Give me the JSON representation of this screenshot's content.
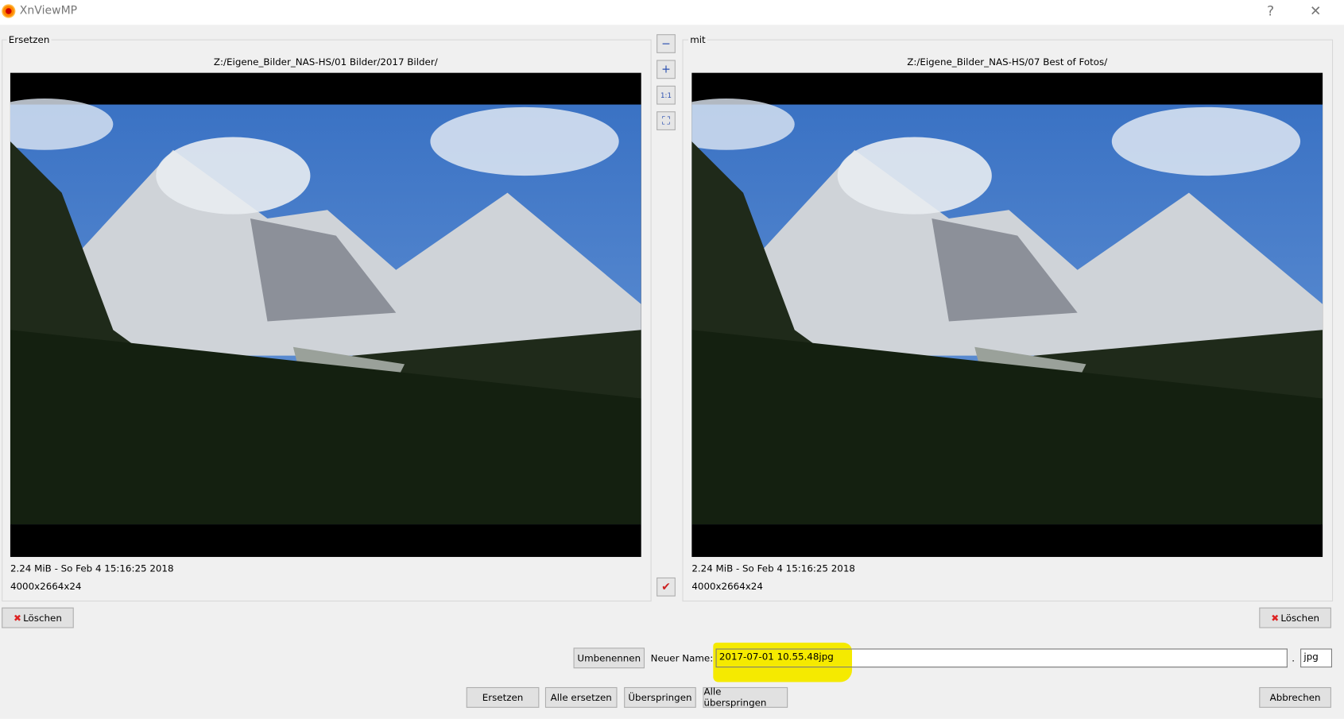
{
  "window": {
    "title": "XnViewMP",
    "help": "?",
    "close": "✕"
  },
  "left": {
    "group_label": "Ersetzen",
    "path": "Z:/Eigene_Bilder_NAS-HS/01 Bilder/2017 Bilder/",
    "info": "2.24 MiB - So Feb 4 15:16:25 2018",
    "dims": "4000x2664x24",
    "delete_label": "Löschen"
  },
  "right": {
    "group_label": "mit",
    "path": "Z:/Eigene_Bilder_NAS-HS/07 Best of Fotos/",
    "info": "2.24 MiB - So Feb 4 15:16:25 2018",
    "dims": "4000x2664x24",
    "delete_label": "Löschen"
  },
  "tools": {
    "zoom_out": "−",
    "zoom_in": "+",
    "zoom_1to1": "1:1",
    "fit": "⛶",
    "check": "✔"
  },
  "rename": {
    "button": "Umbenennen",
    "label": "Neuer Name:",
    "value": "2017-07-01 10.55.48jpg",
    "dot": ".",
    "ext": "jpg"
  },
  "actions": {
    "replace": "Ersetzen",
    "replace_all": "Alle ersetzen",
    "skip": "Überspringen",
    "skip_all": "Alle überspringen",
    "cancel": "Abbrechen"
  },
  "colors": {
    "highlight": "#f5ea00"
  }
}
